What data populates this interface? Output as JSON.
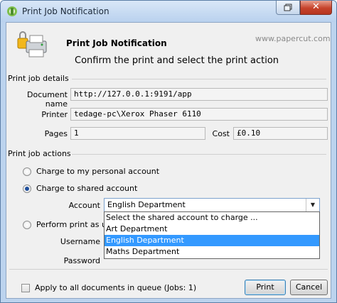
{
  "window": {
    "title": "Print Job Notification"
  },
  "header": {
    "title": "Print Job Notification",
    "url": "www.papercut.com",
    "subtitle": "Confirm the print and select the print action"
  },
  "details": {
    "section_label": "Print job details",
    "document_label": "Document name",
    "document_value": "http://127.0.0.1:9191/app",
    "printer_label": "Printer",
    "printer_value": "tedage-pc\\Xerox Phaser 6110",
    "pages_label": "Pages",
    "pages_value": "1",
    "cost_label": "Cost",
    "cost_value": "£0.10"
  },
  "actions": {
    "section_label": "Print job actions",
    "personal_label": "Charge to my personal account",
    "shared_label": "Charge to shared account",
    "account_label": "Account",
    "account_value": "English Department",
    "perform_label": "Perform print as us",
    "username_label": "Username",
    "password_label": "Password",
    "selected": "shared"
  },
  "dropdown": {
    "items": [
      "Select the shared account to charge ...",
      "Art Department",
      "English Department",
      "Maths Department"
    ],
    "highlighted": "English Department"
  },
  "footer": {
    "apply_label": "Apply to all documents in queue (Jobs: 1)",
    "print_label": "Print",
    "cancel_label": "Cancel"
  }
}
